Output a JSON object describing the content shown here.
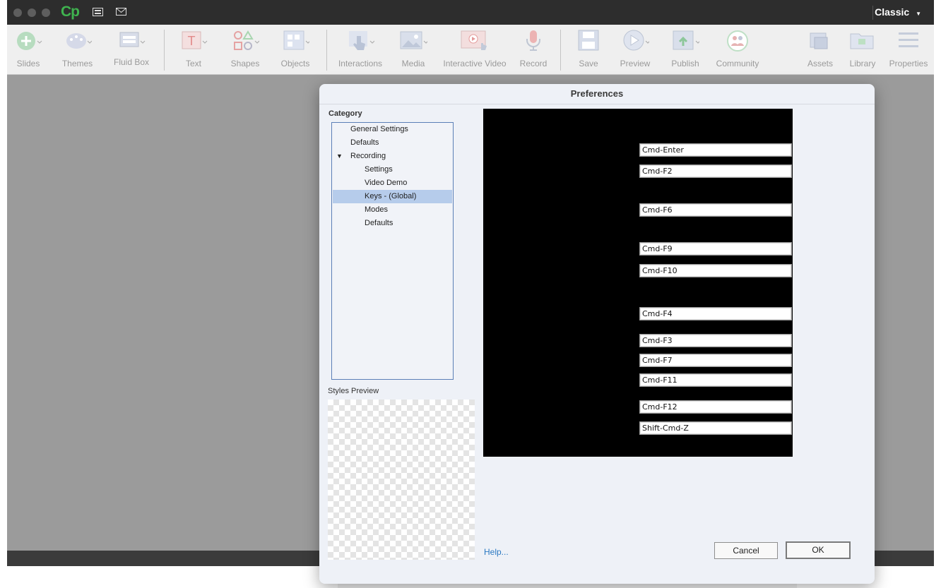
{
  "titlebar": {
    "app_logo": "Cp",
    "workspace": "Classic"
  },
  "toolbar": {
    "slides": "Slides",
    "themes": "Themes",
    "fluid_box": "Fluid Box",
    "text": "Text",
    "shapes": "Shapes",
    "objects": "Objects",
    "interactions": "Interactions",
    "media": "Media",
    "interactive_video": "Interactive Video",
    "record": "Record",
    "save": "Save",
    "preview": "Preview",
    "publish": "Publish",
    "community": "Community",
    "assets": "Assets",
    "library": "Library",
    "properties": "Properties"
  },
  "dialog": {
    "title": "Preferences",
    "category_label": "Category",
    "categories": [
      "General Settings",
      "Defaults",
      "Recording",
      "Settings",
      "Video Demo",
      "Keys - (Global)",
      "Modes",
      "Defaults"
    ],
    "selected_category": "Keys - (Global)",
    "styles_preview_label": "Styles Preview",
    "keys": [
      "Cmd-Enter",
      "Cmd-F2",
      "Cmd-F6",
      "Cmd-F9",
      "Cmd-F10",
      "Cmd-F4",
      "Cmd-F3",
      "Cmd-F7",
      "Cmd-F11",
      "Cmd-F12",
      "Shift-Cmd-Z"
    ],
    "help": "Help...",
    "cancel": "Cancel",
    "ok": "OK"
  },
  "colors": {
    "accent": "#3fb34f",
    "selection": "#b6cceb",
    "link": "#2b79c2"
  }
}
